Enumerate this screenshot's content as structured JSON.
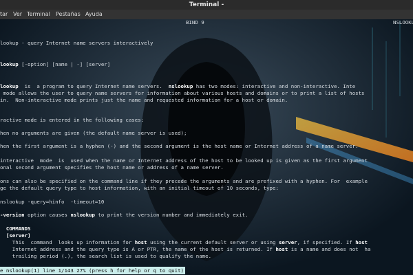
{
  "window": {
    "title": "Terminal -"
  },
  "menu": [
    "tar",
    "Ver",
    "Terminal",
    "Pestañas",
    "Ayuda"
  ],
  "header": {
    "center": "BIND 9",
    "right": "NSLOOKU"
  },
  "lines": [
    {
      "segments": [
        {
          "text": "lookup - query Internet name servers interactively"
        }
      ]
    },
    {
      "segments": [
        {
          "text": "lookup",
          "bold": true
        },
        {
          "text": " [-option] [name | -] [server]"
        }
      ]
    },
    {
      "segments": [
        {
          "text": "lookup",
          "bold": true
        },
        {
          "text": "  is  a program to query Internet name servers.  "
        },
        {
          "text": "nslookup",
          "bold": true
        },
        {
          "text": " has two modes: interactive and non-interactive. Inte"
        }
      ]
    },
    {
      "segments": [
        {
          "text": " mode allows the user to query name servers for information about various hosts and domains or to print a list of hosts"
        }
      ]
    },
    {
      "segments": [
        {
          "text": "in.  Non-interactive mode prints just the name and requested information for a host or domain."
        }
      ]
    },
    {
      "segments": [
        {
          "text": "ractive mode is entered in the following cases:"
        }
      ]
    },
    {
      "segments": [
        {
          "text": "hen no arguments are given (the default name server is used);"
        }
      ]
    },
    {
      "segments": [
        {
          "text": "hen the first argument is a hyphen (-) and the second argument is the host name or Internet address of a name server."
        }
      ]
    },
    {
      "segments": [
        {
          "text": "interactive  mode  is  used when the name or Internet address of the host to be looked up is given as the first argument"
        }
      ]
    },
    {
      "segments": [
        {
          "text": "onal second argument specifies the host name or address of a name server."
        }
      ]
    },
    {
      "segments": [
        {
          "text": "ons can also be specified on the command line if they precede the arguments and are prefixed with a hyphen. For  example"
        }
      ]
    },
    {
      "segments": [
        {
          "text": "ge the default query type to host information, with an initial timeout of 10 seconds, type:"
        }
      ]
    },
    {
      "segments": [
        {
          "text": "nslookup -query=hinfo  -timeout=10"
        }
      ]
    },
    {
      "segments": [
        {
          "text": "-version",
          "bold": true
        },
        {
          "text": " option causes "
        },
        {
          "text": "nslookup",
          "bold": true
        },
        {
          "text": " to print the version number and immediately exit."
        }
      ]
    },
    {
      "segments": [
        {
          "text": "  COMMANDS",
          "bold": true
        }
      ]
    },
    {
      "segments": [
        {
          "text": "  [server]",
          "bold": true
        }
      ]
    },
    {
      "segments": [
        {
          "text": "    This  command  looks up information for "
        },
        {
          "text": "host",
          "bold": true
        },
        {
          "text": " using the current default server or using "
        },
        {
          "text": "server",
          "bold": true
        },
        {
          "text": ", if specified. If "
        },
        {
          "text": "host",
          "bold": true
        }
      ]
    },
    {
      "segments": [
        {
          "text": "    Internet address and the query type is A or PTR, the name of the host is returned. If "
        },
        {
          "text": "host",
          "bold": true
        },
        {
          "text": " is a name and does not  ha"
        }
      ]
    },
    {
      "segments": [
        {
          "text": "    trailing period (.), the search list is used to qualify the name."
        }
      ]
    }
  ],
  "status": {
    "text": "e nslookup(1) line 1/143 27% (press h for help or q to quit)"
  },
  "colors": {
    "status_bg": "#c9ecea",
    "text": "#d8dde2",
    "bg": "#0b1620"
  }
}
